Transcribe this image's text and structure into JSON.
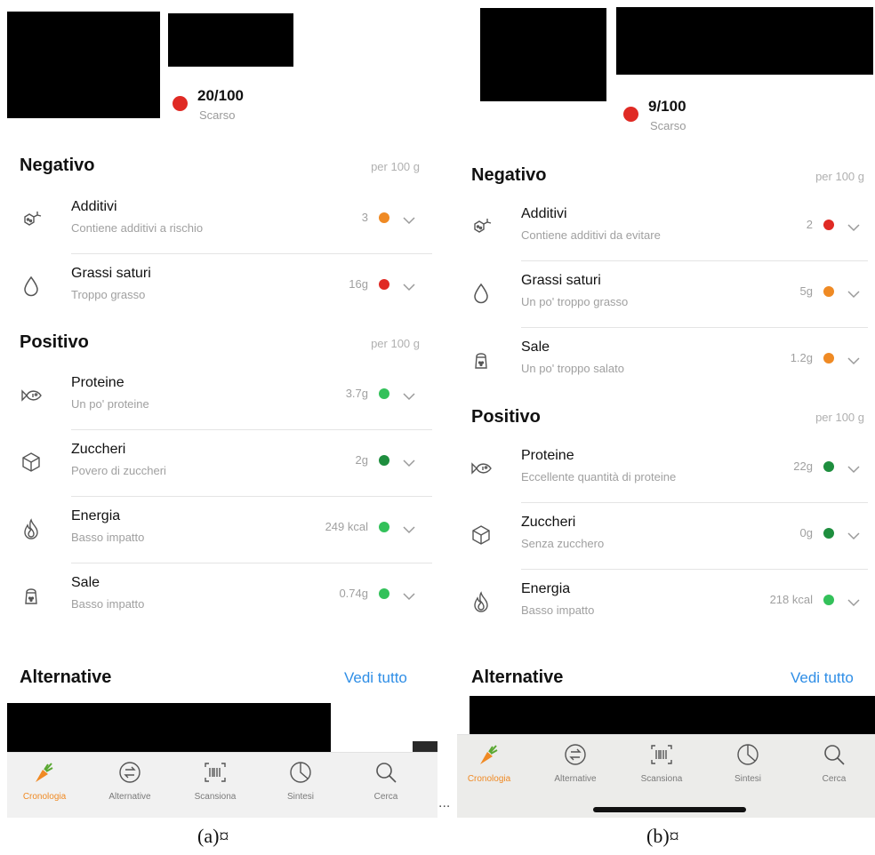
{
  "panel_a": {
    "score": {
      "value": "20/100",
      "label": "Scarso",
      "dot_color": "#e02a24"
    },
    "negative": {
      "title": "Negativo",
      "unit": "per 100 g",
      "rows": [
        {
          "icon": "additive-molecule-icon",
          "name": "Additivi",
          "desc": "Contiene additivi a rischio",
          "amount": "3",
          "dot_color": "#ef8a24"
        },
        {
          "icon": "drop-icon",
          "name": "Grassi saturi",
          "desc": "Troppo grasso",
          "amount": "16g",
          "dot_color": "#e02a24"
        }
      ]
    },
    "positive": {
      "title": "Positivo",
      "unit": "per 100 g",
      "rows": [
        {
          "icon": "fish-icon",
          "name": "Proteine",
          "desc": "Un po' proteine",
          "amount": "3.7g",
          "dot_color": "#33c15a"
        },
        {
          "icon": "sugar-cube-icon",
          "name": "Zuccheri",
          "desc": "Povero di zuccheri",
          "amount": "2g",
          "dot_color": "#1e8e3e"
        },
        {
          "icon": "flame-icon",
          "name": "Energia",
          "desc": "Basso impatto",
          "amount": "249 kcal",
          "dot_color": "#33c15a"
        },
        {
          "icon": "salt-shaker-icon",
          "name": "Sale",
          "desc": "Basso impatto",
          "amount": "0.74g",
          "dot_color": "#33c15a"
        }
      ]
    },
    "alternatives": {
      "title": "Alternative",
      "link": "Vedi tutto"
    },
    "tabs": [
      {
        "icon": "carrot-icon",
        "label": "Cronologia",
        "active": true
      },
      {
        "icon": "swap-icon",
        "label": "Alternative",
        "active": false
      },
      {
        "icon": "barcode-scan-icon",
        "label": "Scansiona",
        "active": false
      },
      {
        "icon": "pie-chart-icon",
        "label": "Sintesi",
        "active": false
      },
      {
        "icon": "search-icon",
        "label": "Cerca",
        "active": false
      }
    ],
    "caption": "(a)¤"
  },
  "panel_b": {
    "score": {
      "value": "9/100",
      "label": "Scarso",
      "dot_color": "#e02a24"
    },
    "negative": {
      "title": "Negativo",
      "unit": "per 100 g",
      "rows": [
        {
          "icon": "additive-molecule-icon",
          "name": "Additivi",
          "desc": "Contiene additivi da evitare",
          "amount": "2",
          "dot_color": "#e02a24"
        },
        {
          "icon": "drop-icon",
          "name": "Grassi saturi",
          "desc": "Un po' troppo grasso",
          "amount": "5g",
          "dot_color": "#ef8a24"
        },
        {
          "icon": "salt-shaker-icon",
          "name": "Sale",
          "desc": "Un po' troppo salato",
          "amount": "1.2g",
          "dot_color": "#ef8a24"
        }
      ]
    },
    "positive": {
      "title": "Positivo",
      "unit": "per 100 g",
      "rows": [
        {
          "icon": "fish-icon",
          "name": "Proteine",
          "desc": "Eccellente quantità di proteine",
          "amount": "22g",
          "dot_color": "#1e8e3e"
        },
        {
          "icon": "sugar-cube-icon",
          "name": "Zuccheri",
          "desc": "Senza zucchero",
          "amount": "0g",
          "dot_color": "#1e8e3e"
        },
        {
          "icon": "flame-icon",
          "name": "Energia",
          "desc": "Basso impatto",
          "amount": "218 kcal",
          "dot_color": "#33c15a"
        }
      ]
    },
    "alternatives": {
      "title": "Alternative",
      "link": "Vedi tutto"
    },
    "tabs": [
      {
        "icon": "carrot-icon",
        "label": "Cronologia",
        "active": true
      },
      {
        "icon": "swap-icon",
        "label": "Alternative",
        "active": false
      },
      {
        "icon": "barcode-scan-icon",
        "label": "Scansiona",
        "active": false
      },
      {
        "icon": "pie-chart-icon",
        "label": "Sintesi",
        "active": false
      },
      {
        "icon": "search-icon",
        "label": "Cerca",
        "active": false
      }
    ],
    "caption": "(b)¤"
  },
  "separator": "..."
}
